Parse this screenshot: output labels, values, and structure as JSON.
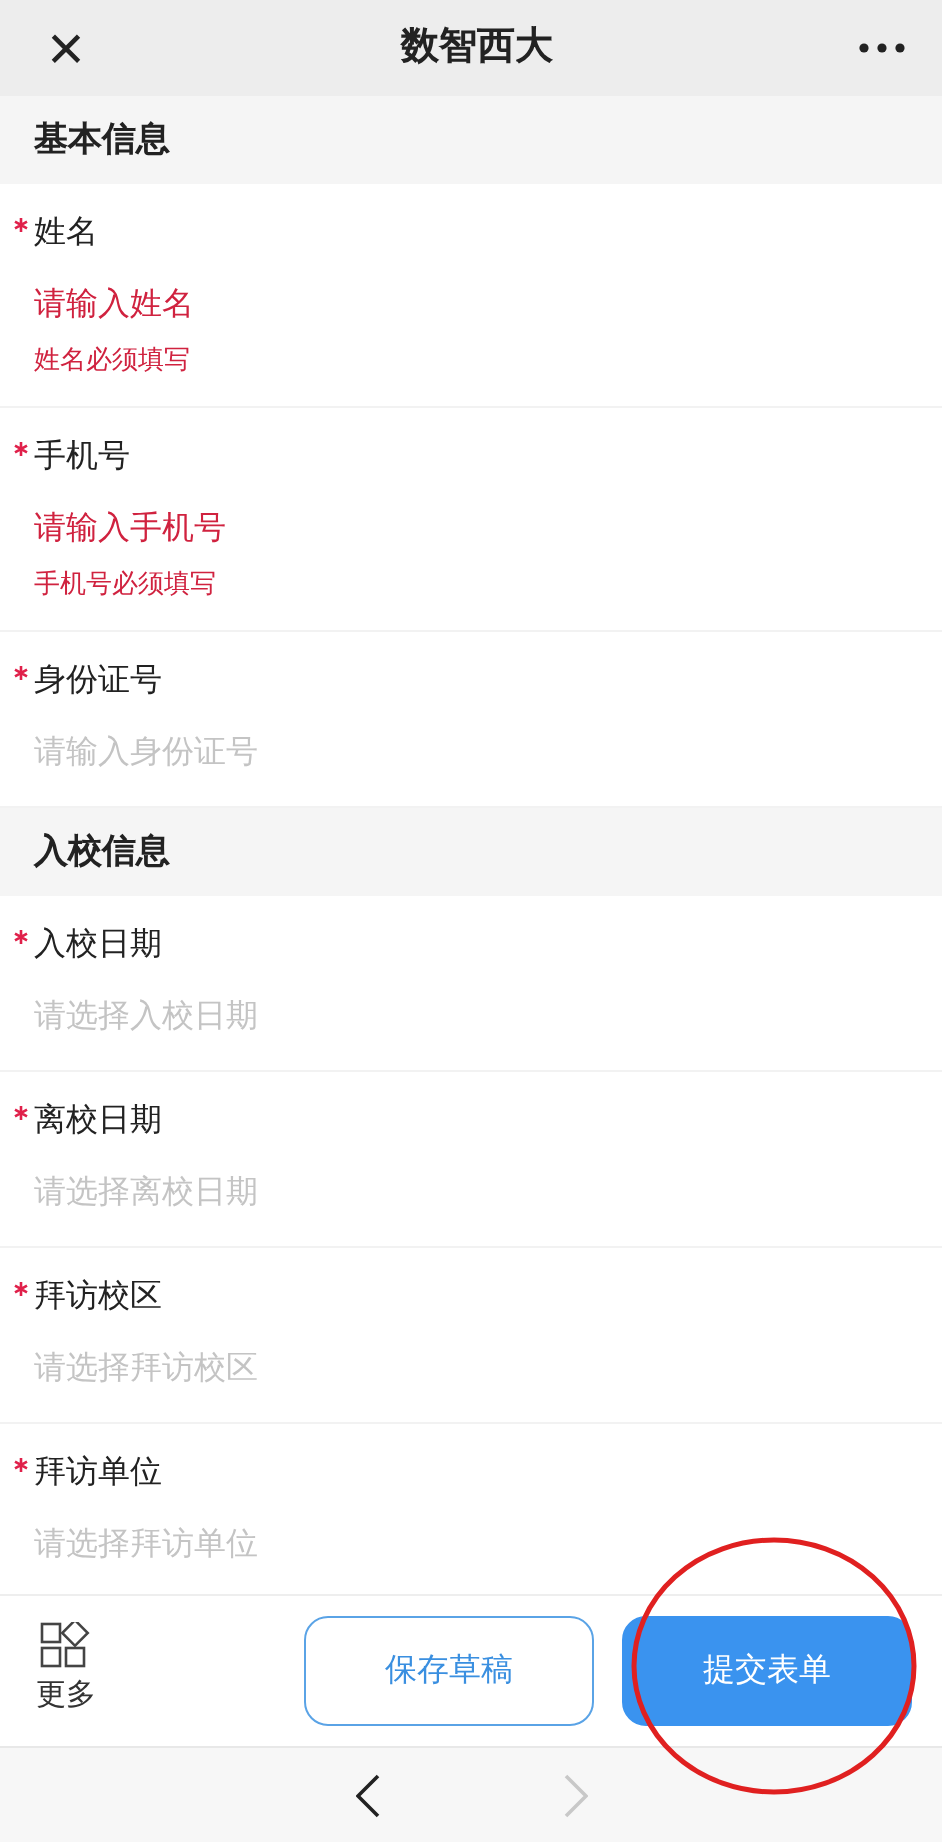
{
  "header": {
    "title": "数智西大",
    "close": "×"
  },
  "sections": [
    {
      "title": "基本信息",
      "fields": [
        {
          "label": "姓名",
          "required": true,
          "placeholder": "请输入姓名",
          "invalid": true,
          "error": "姓名必须填写"
        },
        {
          "label": "手机号",
          "required": true,
          "placeholder": "请输入手机号",
          "invalid": true,
          "error": "手机号必须填写"
        },
        {
          "label": "身份证号",
          "required": true,
          "placeholder": "请输入身份证号",
          "invalid": false
        }
      ]
    },
    {
      "title": "入校信息",
      "fields": [
        {
          "label": "入校日期",
          "required": true,
          "placeholder": "请选择入校日期",
          "invalid": false
        },
        {
          "label": "离校日期",
          "required": true,
          "placeholder": "请选择离校日期",
          "invalid": false
        },
        {
          "label": "拜访校区",
          "required": true,
          "placeholder": "请选择拜访校区",
          "invalid": false
        },
        {
          "label": "拜访单位",
          "required": true,
          "placeholder": "请选择拜访单位",
          "invalid": false
        }
      ]
    }
  ],
  "toolbar": {
    "more": "更多",
    "buttons": [
      {
        "label": "保存草稿",
        "kind": "outline"
      },
      {
        "label": "提交表单",
        "kind": "primary"
      }
    ]
  },
  "nav": {
    "back_disabled": false,
    "forward_disabled": true
  }
}
